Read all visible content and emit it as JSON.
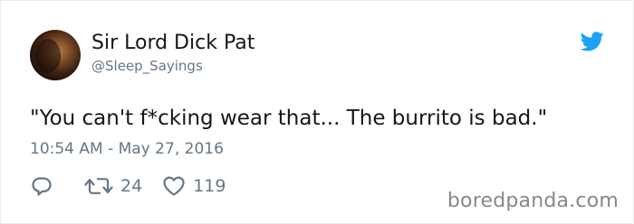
{
  "tweet": {
    "author": {
      "display_name": "Sir Lord Dick Pat",
      "handle": "@Sleep_Sayings"
    },
    "text": "\"You can't f*cking wear that... The burrito is bad.\"",
    "timestamp": "10:54 AM - May 27, 2016",
    "actions": {
      "reply_icon": "reply-icon",
      "retweet_icon": "retweet-icon",
      "retweet_count": "24",
      "like_icon": "heart-icon",
      "like_count": "119"
    },
    "brand_icon": "twitter-bird-icon"
  },
  "watermark": "boredpanda.com",
  "colors": {
    "text": "#14171a",
    "secondary": "#657786",
    "twitter_blue": "#1da1f2",
    "watermark": "#888888"
  }
}
